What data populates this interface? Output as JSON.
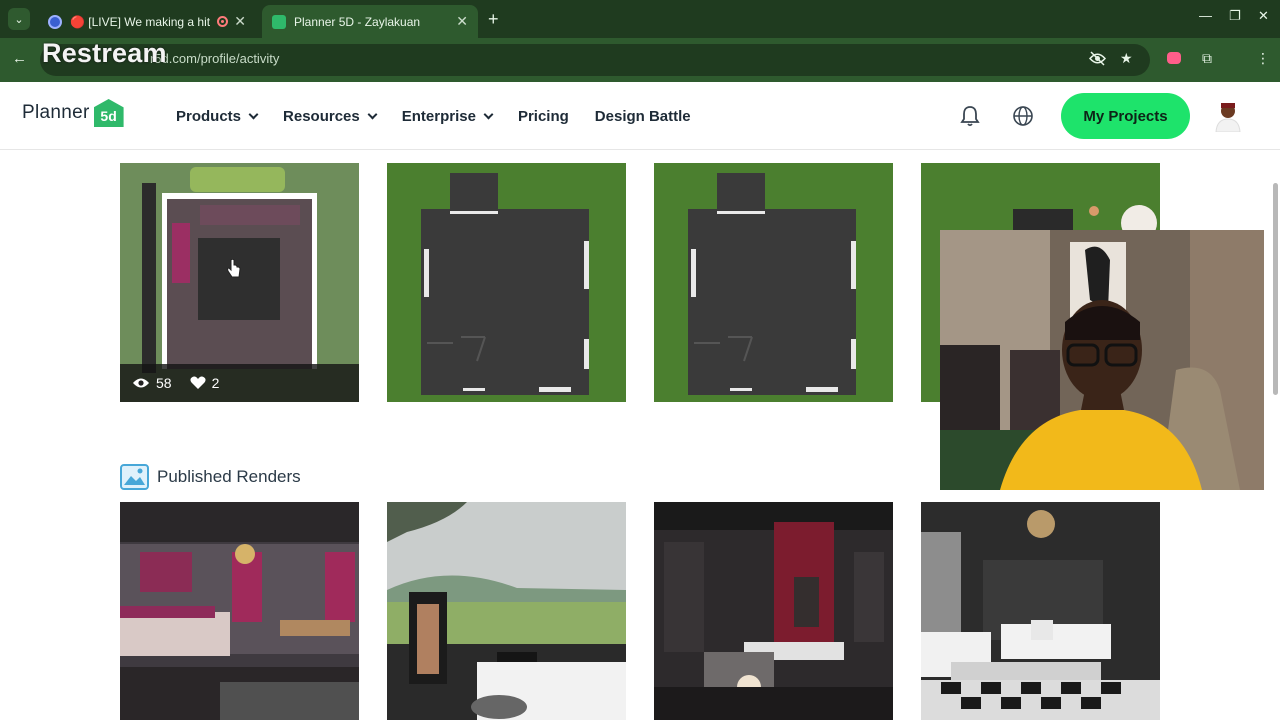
{
  "browser": {
    "tabs": [
      {
        "title": "🔴 [LIVE] We making a hit f",
        "active": false
      },
      {
        "title": "Planner 5D - Zaylakuan",
        "active": true
      }
    ],
    "url_prefix": "r5d.com/profile/activity",
    "overlay_brand": "Restream"
  },
  "site": {
    "logo_text": "Planner",
    "logo_mark": "5d",
    "nav": [
      {
        "label": "Products",
        "dropdown": true
      },
      {
        "label": "Resources",
        "dropdown": true
      },
      {
        "label": "Enterprise",
        "dropdown": true
      },
      {
        "label": "Pricing",
        "dropdown": false
      },
      {
        "label": "Design Battle",
        "dropdown": false
      }
    ],
    "cta": "My Projects"
  },
  "projects": [
    {
      "views": "58",
      "likes": "2",
      "kind": "interior-top-view"
    },
    {
      "kind": "empty-plan"
    },
    {
      "kind": "empty-plan"
    },
    {
      "kind": "interior-partial"
    }
  ],
  "renders_section": {
    "title": "Published Renders",
    "items": [
      "bedroom-render",
      "outdoor-render",
      "lounge-render",
      "living-room-render"
    ]
  },
  "colors": {
    "chrome_dark": "#1f3b1f",
    "chrome": "#2e5a2e",
    "accent": "#1ee36b",
    "plan_green": "#4b7f2f"
  },
  "icons": [
    "bell-icon",
    "globe-icon",
    "eye-icon",
    "heart-icon",
    "image-gallery-icon"
  ]
}
